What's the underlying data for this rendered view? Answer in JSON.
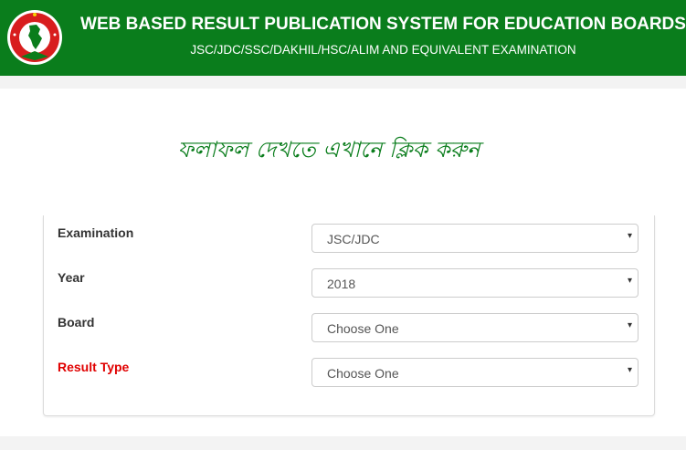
{
  "header": {
    "title": "WEB BASED RESULT PUBLICATION SYSTEM FOR EDUCATION BOARDS",
    "subtitle": "JSC/JDC/SSC/DAKHIL/HSC/ALIM AND EQUIVALENT EXAMINATION",
    "logo_icon": "government-seal-icon",
    "color": "#0a7d1c"
  },
  "main": {
    "click_here": "ফলাফল দেখতে এখানে ক্লিক  করুন"
  },
  "form": {
    "examination": {
      "label": "Examination",
      "value": "JSC/JDC"
    },
    "year": {
      "label": "Year",
      "value": "2018"
    },
    "board": {
      "label": "Board",
      "value": "Choose One"
    },
    "result_type": {
      "label": "Result Type",
      "value": "Choose One",
      "label_color": "#e00000"
    },
    "caret": "▾"
  }
}
